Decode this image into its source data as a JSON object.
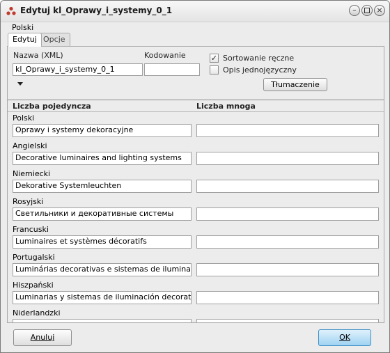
{
  "window": {
    "title": "Edytuj kl_Oprawy_i_systemy_0_1"
  },
  "language_label": "Polski",
  "tabs": [
    {
      "label": "Edytuj"
    },
    {
      "label": "Opcje"
    }
  ],
  "form": {
    "name_label": "Nazwa (XML)",
    "name_value": "kl_Oprawy_i_systemy_0_1",
    "encoding_label": "Kodowanie",
    "encoding_value": "",
    "manual_sort_label": "Sortowanie ręczne",
    "manual_sort_checked": true,
    "single_lang_label": "Opis jednojęzyczny",
    "single_lang_checked": false,
    "translate_button": "Tłumaczenie"
  },
  "columns": {
    "singular": "Liczba pojedyncza",
    "plural": "Liczba mnoga"
  },
  "rows": [
    {
      "language": "Polski",
      "singular": "Oprawy i systemy dekoracyjne",
      "plural": ""
    },
    {
      "language": "Angielski",
      "singular": "Decorative luminaires and lighting systems",
      "plural": ""
    },
    {
      "language": "Niemiecki",
      "singular": "Dekorative Systemleuchten",
      "plural": ""
    },
    {
      "language": "Rosyjski",
      "singular": "Светильники и декоративные системы",
      "plural": ""
    },
    {
      "language": "Francuski",
      "singular": "Luminaires et systèmes décoratifs",
      "plural": ""
    },
    {
      "language": "Portugalski",
      "singular": "Luminárias decorativas e sistemas de iluminação",
      "plural": ""
    },
    {
      "language": "Hiszpański",
      "singular": "Luminarias y sistemas de iluminación decorativos",
      "plural": ""
    },
    {
      "language": "Niderlandzki",
      "singular": "",
      "plural": ""
    }
  ],
  "footer": {
    "cancel_label": "Anuluj",
    "ok_label": "OK"
  },
  "colors": {
    "ok_accent": "#9fd3f2",
    "window_bg": "#ececec"
  }
}
